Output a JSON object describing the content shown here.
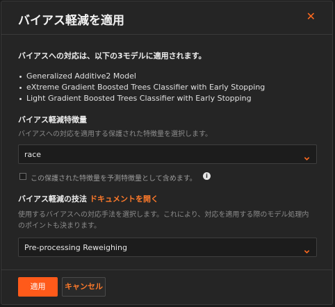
{
  "dialog": {
    "title": "バイアス軽減を適用",
    "close_icon": "close-icon"
  },
  "intro": {
    "text": "バイアスへの対応は、以下の3モデルに適用されます。",
    "models": [
      "Generalized Additive2 Model",
      "eXtreme Gradient Boosted Trees Classifier with Early Stopping",
      "Light Gradient Boosted Trees Classifier with Early Stopping"
    ]
  },
  "feature": {
    "title": "バイアス軽減特徴量",
    "help": "バイアスへの対応を適用する保護された特徴量を選択します。",
    "selected": "race",
    "checkbox_label": "この保護された特徴量を予測特徴量として含めます。",
    "checked": false
  },
  "technique": {
    "title": "バイアス軽減の技法",
    "doc_link": "ドキュメントを開く",
    "help_line1": "使用するバイアスへの対応手法を選択します。これにより、対応を適用する際のモデル処理内",
    "help_line2": "のポイントも決まります。",
    "selected": "Pre-processing Reweighing"
  },
  "footer": {
    "apply_label": "適用",
    "cancel_label": "キャンセル"
  },
  "colors": {
    "accent": "#ff5a1a",
    "link": "#ff7a2a",
    "background": "#252525"
  }
}
